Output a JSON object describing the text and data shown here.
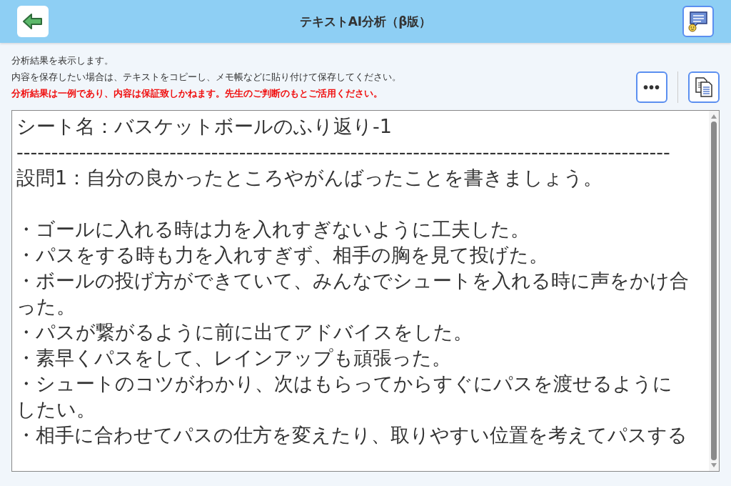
{
  "header": {
    "title": "テキストAI分析（β版）"
  },
  "notices": [
    {
      "kind": "info",
      "text": "分析結果を表示します。"
    },
    {
      "kind": "info",
      "text": "内容を保存したい場合は、テキストをコピーし、メモ帳などに貼り付けて保存してください。"
    },
    {
      "kind": "warning",
      "text": "分析結果は一例であり、内容は保証致しかねます。先生のご判断のもとご活用ください。"
    }
  ],
  "more_button": {
    "label": "•••"
  },
  "result_text": {
    "lines": [
      "シート名：バスケットボールのふり返り-1",
      "----------------------------------------------------------------------------------------------",
      "設問1：自分の良かったところやがんばったことを書きましょう。",
      {
        "text": "・ゴールに入れる時は力を入れすぎないように工夫した。",
        "space_before": true
      },
      "・パスをする時も力を入れすぎず、相手の胸を見て投げた。",
      "・ボールの投げ方ができていて、みんなでシュートを入れる時に声をかけ合った。",
      "・パスが繋がるように前に出てアドバイスをした。",
      "・素早くパスをして、レインアップも頑張った。",
      "・シュートのコツがわかり、次はもらってからすぐにパスを渡せるようにしたい。",
      "・相手に合わせてパスの仕方を変えたり、取りやすい位置を考えてパスする"
    ]
  }
}
